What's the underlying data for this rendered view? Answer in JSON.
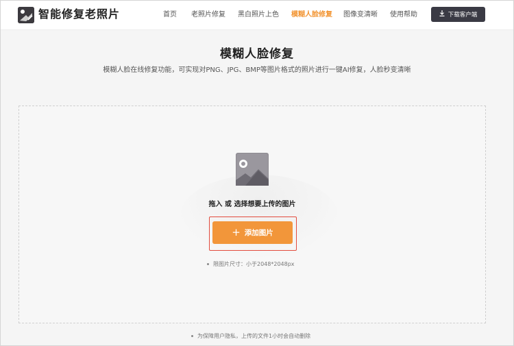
{
  "header": {
    "site_title": "智能修复老照片",
    "nav": [
      {
        "label": "首页",
        "active": false
      },
      {
        "label": "老照片修复",
        "active": false
      },
      {
        "label": "黑白照片上色",
        "active": false
      },
      {
        "label": "模糊人脸修复",
        "active": true
      },
      {
        "label": "图像变清晰",
        "active": false
      },
      {
        "label": "使用帮助",
        "active": false
      }
    ],
    "download_label": "下载客户端",
    "download_icon": "download-icon"
  },
  "main": {
    "title": "模糊人脸修复",
    "subtitle": "模糊人脸在线修复功能，可实现对PNG、JPG、BMP等图片格式的照片进行一键AI修复，人脸秒变清晰"
  },
  "upload": {
    "icon": "image-placeholder-icon",
    "prompt": "拖入 或 选择想要上传的图片",
    "add_button_label": "添加图片",
    "add_button_icon": "plus-icon",
    "size_limit": "限图片尺寸：小于2048*2048px"
  },
  "footer": {
    "privacy_note": "为保障用户隐私，上传的文件1小时会自动删除"
  },
  "colors": {
    "accent": "#f2963a",
    "highlight_border": "#e24a3c",
    "dark_button": "#3a3a44"
  }
}
